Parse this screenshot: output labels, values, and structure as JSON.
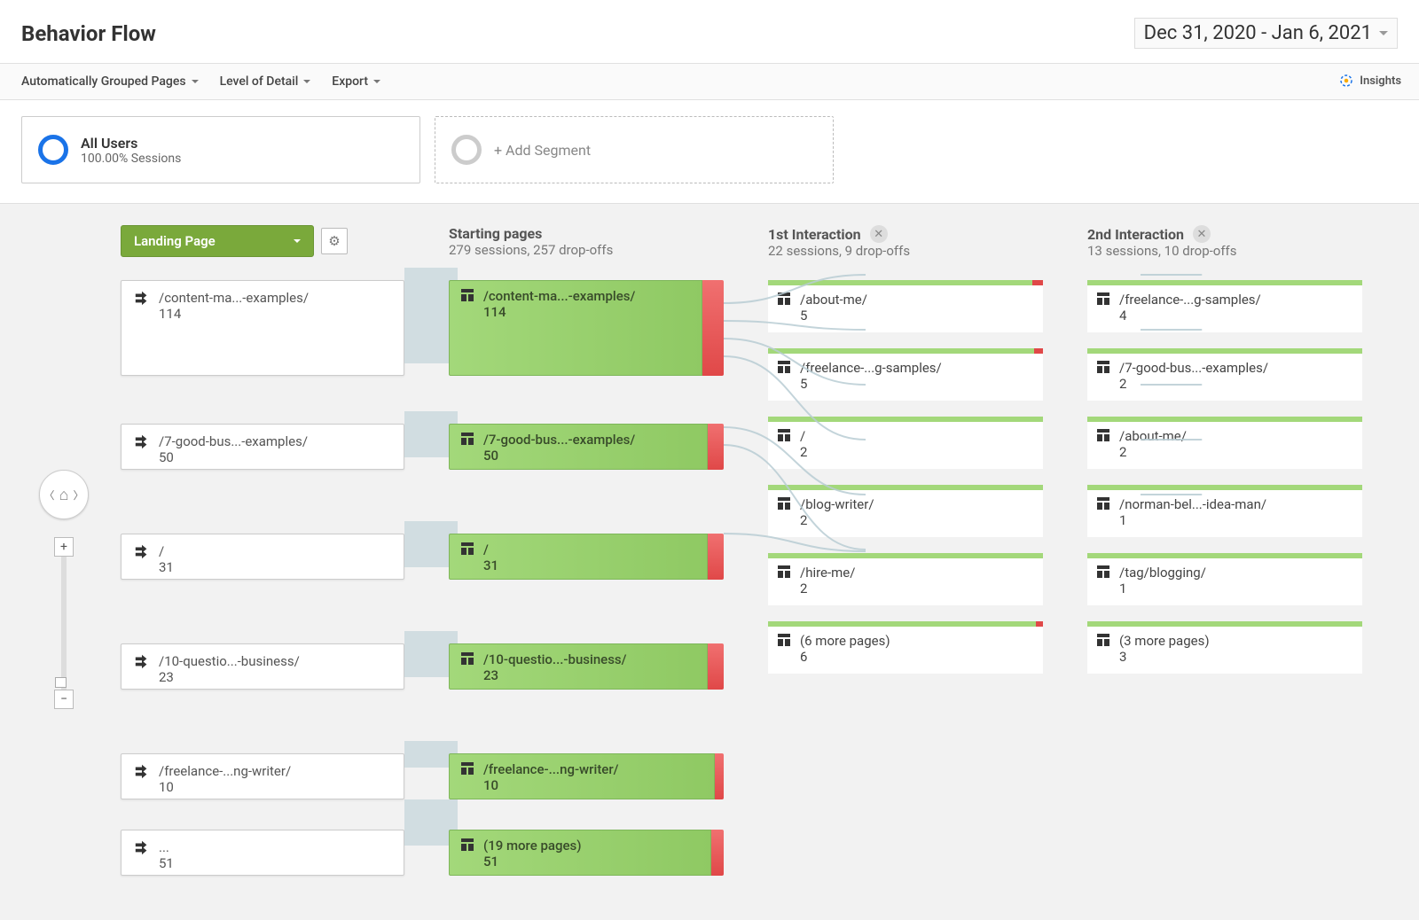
{
  "page_title": "Behavior Flow",
  "date_range": "Dec 31, 2020 - Jan 6, 2021",
  "toolbar": {
    "grouped_pages": "Automatically Grouped Pages",
    "level_detail": "Level of Detail",
    "export": "Export",
    "insights": "Insights"
  },
  "segments": {
    "active": {
      "title": "All Users",
      "sub": "100.00% Sessions"
    },
    "add_label": "+ Add Segment"
  },
  "landing_pill": "Landing Page",
  "zoom": {
    "in": "+",
    "out": "−"
  },
  "columns": [
    {
      "title": "Starting pages",
      "sub": "279 sessions, 257 drop-offs",
      "closeable": false,
      "nodes": [
        {
          "path": "/content-ma...-examples/",
          "count": "114"
        },
        {
          "path": "/7-good-bus...-examples/",
          "count": "50"
        },
        {
          "path": "/",
          "count": "31"
        },
        {
          "path": "/10-questio...-business/",
          "count": "23"
        },
        {
          "path": "/freelance-...ng-writer/",
          "count": "10"
        },
        {
          "path": "(19 more pages)",
          "count": "51"
        }
      ]
    },
    {
      "title": "1st Interaction",
      "sub": "22 sessions, 9 drop-offs",
      "closeable": true,
      "nodes": [
        {
          "path": "/about-me/",
          "count": "5"
        },
        {
          "path": "/freelance-...g-samples/",
          "count": "5"
        },
        {
          "path": "/",
          "count": "2"
        },
        {
          "path": "/blog-writer/",
          "count": "2"
        },
        {
          "path": "/hire-me/",
          "count": "2"
        },
        {
          "path": "(6 more pages)",
          "count": "6"
        }
      ]
    },
    {
      "title": "2nd Interaction",
      "sub": "13 sessions, 10 drop-offs",
      "closeable": true,
      "nodes": [
        {
          "path": "/freelance-...g-samples/",
          "count": "4"
        },
        {
          "path": "/7-good-bus...-examples/",
          "count": "2"
        },
        {
          "path": "/about-me/",
          "count": "2"
        },
        {
          "path": "/norman-bel...-idea-man/",
          "count": "1"
        },
        {
          "path": "/tag/blogging/",
          "count": "1"
        },
        {
          "path": "(3 more pages)",
          "count": "3"
        }
      ]
    }
  ],
  "landing_nodes": [
    {
      "path": "/content-ma...-examples/",
      "count": "114"
    },
    {
      "path": "/7-good-bus...-examples/",
      "count": "50"
    },
    {
      "path": "/",
      "count": "31"
    },
    {
      "path": "/10-questio...-business/",
      "count": "23"
    },
    {
      "path": "/freelance-...ng-writer/",
      "count": "10"
    },
    {
      "path": "...",
      "count": "51"
    }
  ]
}
